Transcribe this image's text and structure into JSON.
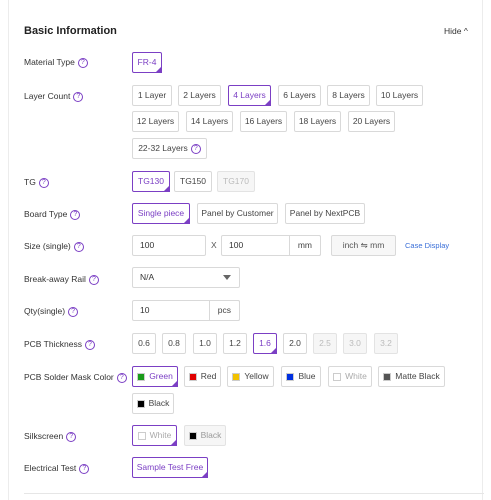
{
  "section": {
    "title": "Basic Information",
    "hide_label": "Hide ^"
  },
  "help_glyph": "?",
  "material": {
    "label": "Material Type",
    "options": [
      "FR-4"
    ]
  },
  "layers": {
    "label": "Layer Count",
    "options": [
      "1 Layer",
      "2 Layers",
      "4 Layers",
      "6 Layers",
      "8 Layers",
      "10 Layers",
      "12 Layers",
      "14 Layers",
      "16 Layers",
      "18 Layers",
      "20 Layers",
      "22-32 Layers"
    ],
    "selected": "4 Layers"
  },
  "tg": {
    "label": "TG",
    "options": [
      "TG130",
      "TG150",
      "TG170"
    ],
    "selected": "TG130",
    "disabled": "TG170"
  },
  "board_type": {
    "label": "Board Type",
    "options": [
      "Single piece",
      "Panel by Customer",
      "Panel by NextPCB"
    ],
    "selected": "Single piece"
  },
  "size": {
    "label": "Size (single)",
    "width": "100",
    "times": "X",
    "height": "100",
    "unit": "mm",
    "unit_switch": "inch ⇋ mm",
    "case_display": "Case Display"
  },
  "break_away": {
    "label": "Break-away Rail",
    "value": "N/A"
  },
  "qty": {
    "label": "Qty(single)",
    "value": "10",
    "unit": "pcs"
  },
  "thickness": {
    "label": "PCB Thickness",
    "options": [
      "0.6",
      "0.8",
      "1.0",
      "1.2",
      "1.6",
      "2.0",
      "2.5",
      "3.0",
      "3.2"
    ],
    "selected": "1.6"
  },
  "mask": {
    "label": "PCB Solder Mask Color",
    "options": [
      {
        "label": "Green",
        "color": "#1a9b1a"
      },
      {
        "label": "Red",
        "color": "#e00000"
      },
      {
        "label": "Yellow",
        "color": "#f2c200"
      },
      {
        "label": "Blue",
        "color": "#0030e0"
      },
      {
        "label": "White",
        "color": "#ffffff"
      },
      {
        "label": "Matte Black",
        "color": "#555555"
      },
      {
        "label": "Black",
        "color": "#000000"
      }
    ],
    "selected": "Green"
  },
  "silkscreen": {
    "label": "Silkscreen",
    "options": [
      {
        "label": "White",
        "color": "#ffffff"
      },
      {
        "label": "Black",
        "color": "#000000"
      }
    ],
    "selected": "White"
  },
  "electrical": {
    "label": "Electrical Test",
    "options": [
      "Sample Test Free"
    ],
    "selected": "Sample Test Free"
  }
}
